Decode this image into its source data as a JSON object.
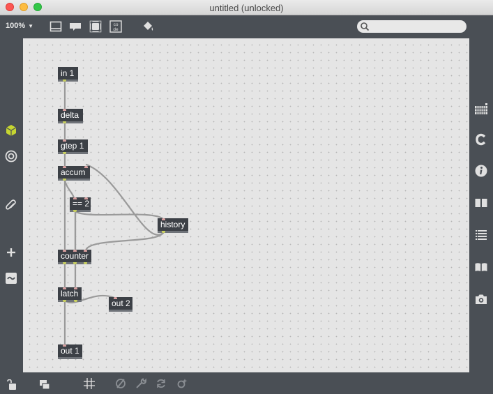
{
  "window": {
    "title": "untitled (unlocked)"
  },
  "toolbar": {
    "zoom": "100%",
    "icons": [
      "presentation-icon",
      "comment-icon",
      "fullscreen-icon",
      "code-icon",
      "paint-bucket-icon"
    ],
    "code_icon_text_top": "co",
    "code_icon_text_bottom": "de"
  },
  "search": {
    "placeholder": "",
    "value": ""
  },
  "left_sidebar": [
    "package-icon",
    "target-icon",
    "paperclip-icon",
    "plus-icon",
    "tilde-icon"
  ],
  "right_sidebar": [
    "grid-icon",
    "clippings-icon",
    "info-icon",
    "book-open-icon",
    "list-icon",
    "reference-icon",
    "snapshot-icon"
  ],
  "patch": {
    "objects": {
      "in1": "in 1",
      "delta": "delta",
      "gtep1": "gtep 1",
      "accum": "accum",
      "eq2": "== 2",
      "history": "history",
      "counter": "counter",
      "latch": "latch",
      "out2": "out 2",
      "out1": "out 1"
    }
  },
  "bottom_bar": [
    "lock-icon",
    "windows-icon",
    "grid-toggle-icon",
    "disable-icon",
    "wrench-icon",
    "refresh-icon",
    "magic-icon"
  ],
  "colors": {
    "object_bg": "#3c4046",
    "canvas": "#e5e5e5",
    "inlet": "#d8a0a0",
    "outlet": "#c9d060",
    "chrome": "#4a4f55",
    "accent": "#c6d631"
  }
}
